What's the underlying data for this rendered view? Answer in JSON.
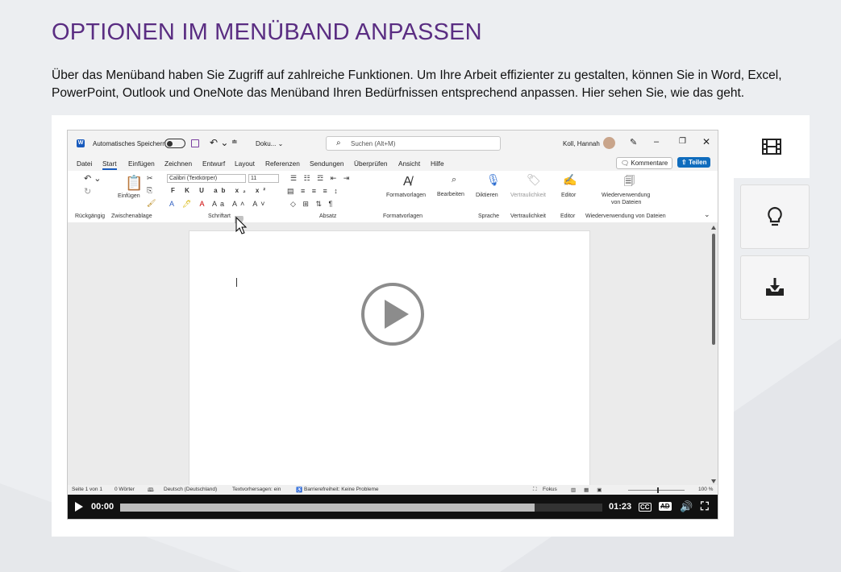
{
  "heading": "OPTIONEN IM MENÜBAND ANPASSEN",
  "intro": "Über das Menüband haben Sie Zugriff auf zahlreiche Funktionen. Um Ihre Arbeit effizienter zu gestalten, können Sie in Word, Excel, PowerPoint, Outlook und OneNote das Menüband Ihren Bedürfnissen entsprechend anpassen. Hier sehen Sie, wie das geht.",
  "colors": {
    "heading": "#5a2d82",
    "accent": "#0f6cbd"
  },
  "word": {
    "autosave": "Automatisches Speichern",
    "doc_name": "Doku... ⌄",
    "search_placeholder": "Suchen (Alt+M)",
    "user": "Koll, Hannah",
    "tabs": [
      "Datei",
      "Start",
      "Einfügen",
      "Zeichnen",
      "Entwurf",
      "Layout",
      "Referenzen",
      "Sendungen",
      "Überprüfen",
      "Ansicht",
      "Hilfe"
    ],
    "comments_button": "Kommentare",
    "share_button": "Teilen",
    "font_name": "Calibri (Textkörper)",
    "font_size": "11",
    "ribbon": {
      "paste": "Einfügen",
      "styles": "Formatvorlagen",
      "edit": "Bearbeiten",
      "dictate": "Diktieren",
      "sensitivity": "Vertraulichkeit",
      "editor": "Editor",
      "reuse_line1": "Wiederverwendung",
      "reuse_line2": "von Dateien"
    },
    "groups": [
      "Rückgängig",
      "Zwischenablage",
      "Schriftart",
      "Absatz",
      "Formatvorlagen",
      "Sprache",
      "Vertraulichkeit",
      "Editor",
      "Wiederverwendung von Dateien"
    ],
    "status": {
      "page": "Seite 1 von 1",
      "words": "0 Wörter",
      "language": "Deutsch (Deutschland)",
      "predictions": "Textvorhersagen: ein",
      "accessibility": "Barrierefreiheit: Keine Probleme",
      "focus": "Fokus",
      "zoom": "100 %"
    }
  },
  "player": {
    "current_time": "00:00",
    "duration": "01:23",
    "progress": 0.86,
    "cc_label": "CC",
    "ad_label": "AD"
  },
  "sidebar": {
    "video_icon": "film-icon",
    "tip_icon": "lightbulb-icon",
    "download_icon": "download-icon"
  }
}
